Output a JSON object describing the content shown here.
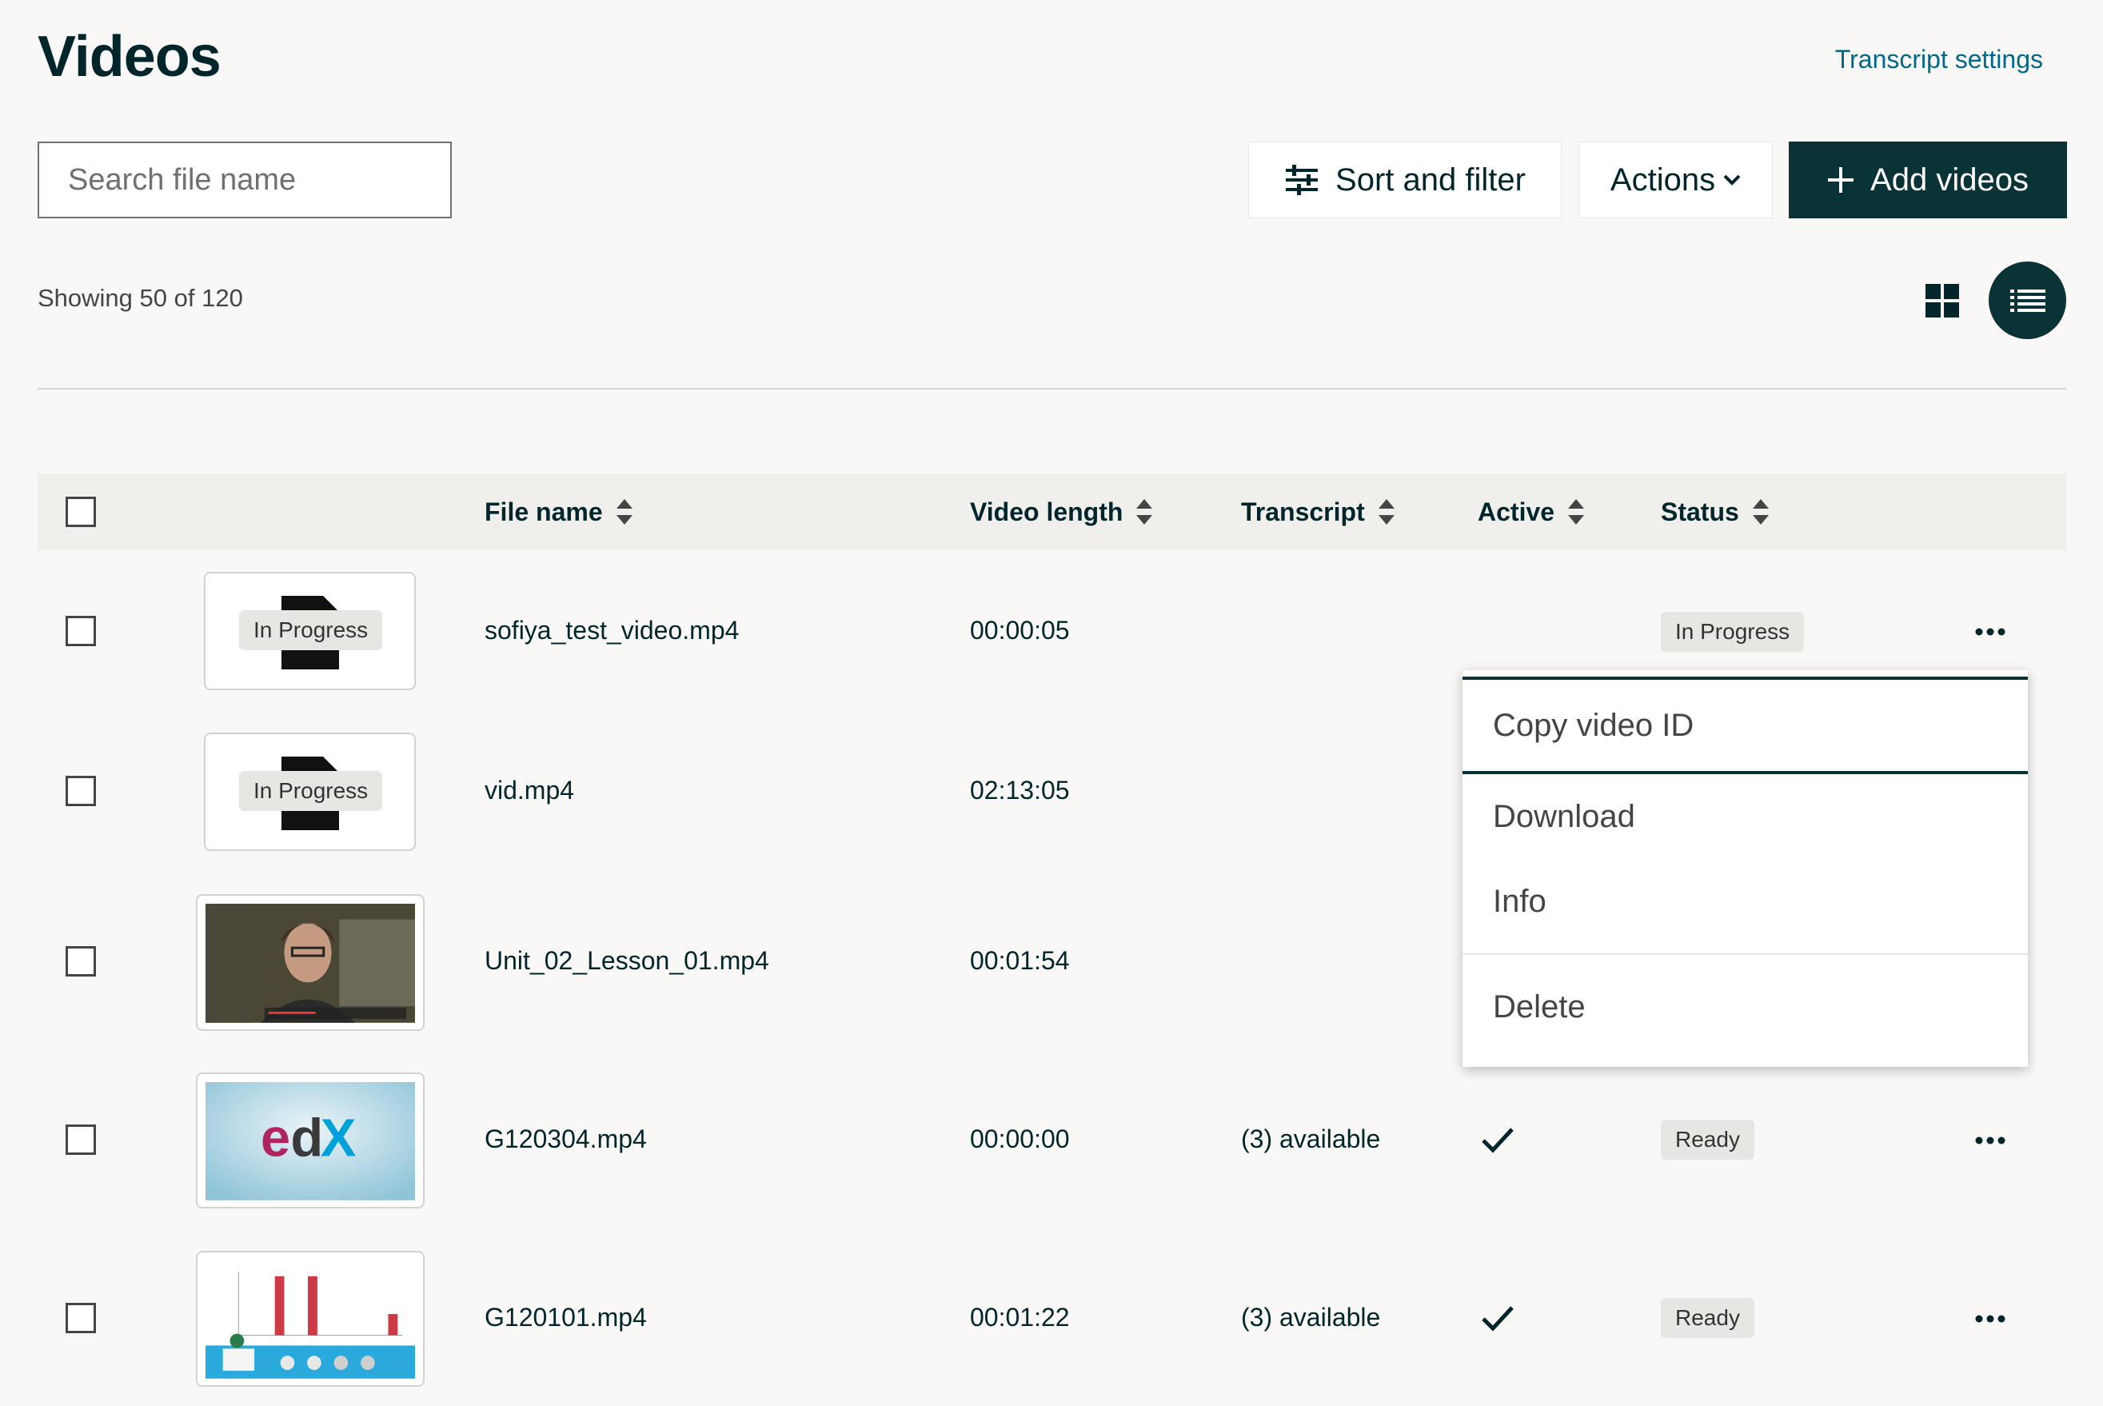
{
  "header": {
    "title": "Videos",
    "transcript_settings": "Transcript settings"
  },
  "toolbar": {
    "search_placeholder": "Search file name",
    "sort_label": "Sort and filter",
    "actions_label": "Actions",
    "add_label": "Add videos"
  },
  "summary": {
    "showing": "Showing 50 of 120"
  },
  "table": {
    "columns": [
      "File name",
      "Video length",
      "Transcript",
      "Active",
      "Status"
    ],
    "rows": [
      {
        "file": "sofiya_test_video.mp4",
        "length": "00:00:05",
        "transcript": "",
        "active": false,
        "status": "In Progress",
        "thumb_badge": "In Progress",
        "thumb": "placeholder"
      },
      {
        "file": "vid.mp4",
        "length": "02:13:05",
        "transcript": "",
        "active": false,
        "status": "",
        "thumb_badge": "In Progress",
        "thumb": "placeholder"
      },
      {
        "file": "Unit_02_Lesson_01.mp4",
        "length": "00:01:54",
        "transcript": "",
        "active": false,
        "status": "",
        "thumb_badge": "",
        "thumb": "lecture"
      },
      {
        "file": "G120304.mp4",
        "length": "00:00:00",
        "transcript": "(3) available",
        "active": true,
        "status": "Ready",
        "thumb_badge": "",
        "thumb": "edx-logo"
      },
      {
        "file": "G120101.mp4",
        "length": "00:01:22",
        "transcript": "(3) available",
        "active": true,
        "status": "Ready",
        "thumb_badge": "",
        "thumb": "bar-chart-slide"
      }
    ]
  },
  "menu": {
    "items": [
      "Copy video ID",
      "Download",
      "Info",
      "Delete"
    ]
  },
  "colors": {
    "primary_dark": "#0a3338",
    "link": "#00688d",
    "background": "#f9f8f6"
  },
  "icons": [
    "sliders-icon",
    "chevron-down-icon",
    "plus-icon",
    "grid-view-icon",
    "list-view-icon",
    "sort-icon",
    "more-icon",
    "check-icon"
  ]
}
